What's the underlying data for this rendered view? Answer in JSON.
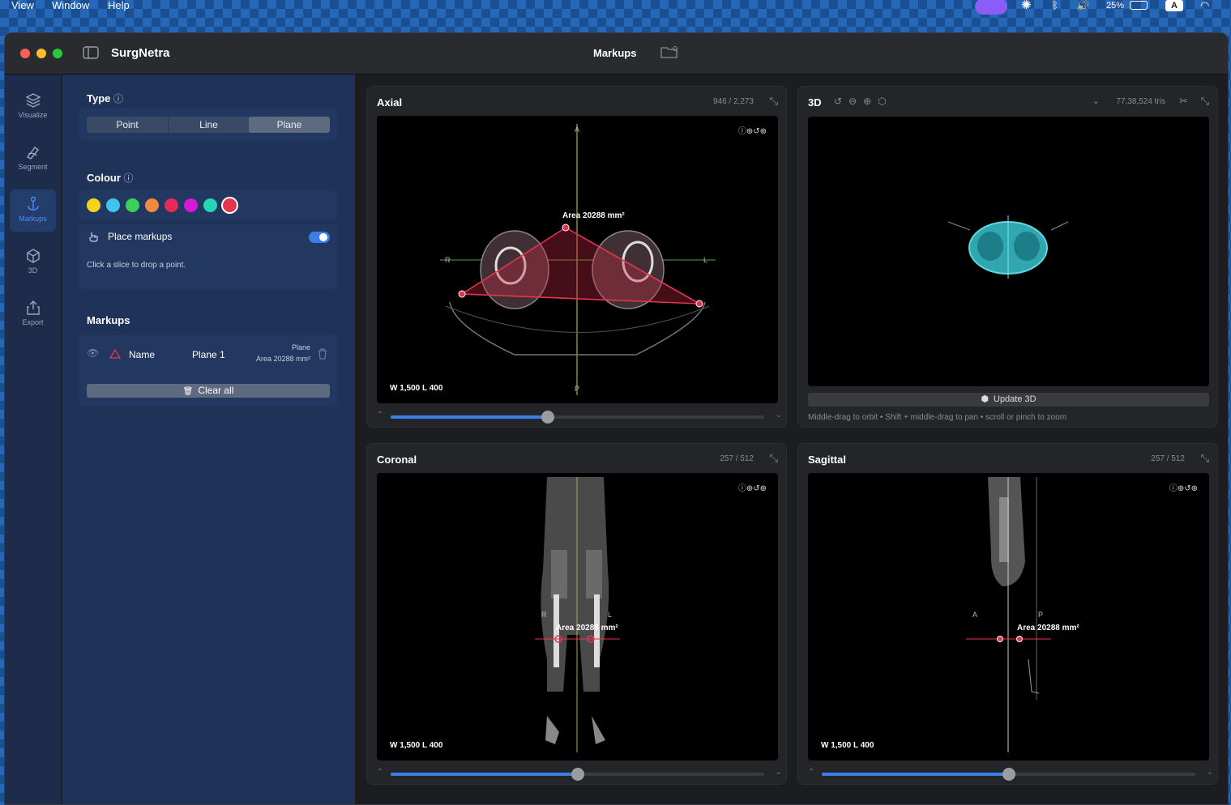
{
  "menubar": {
    "view": "View",
    "window": "Window",
    "help": "Help",
    "battery": "25%"
  },
  "app": {
    "title": "SurgNetra",
    "center_title": "Markups"
  },
  "rail": [
    {
      "label": "Visualize",
      "icon": "layers-icon"
    },
    {
      "label": "Segment",
      "icon": "brush-icon"
    },
    {
      "label": "Markups",
      "icon": "pin-icon",
      "active": true
    },
    {
      "label": "3D",
      "icon": "cube-icon"
    },
    {
      "label": "Export",
      "icon": "share-icon"
    }
  ],
  "panel": {
    "type_title": "Type",
    "types": [
      "Point",
      "Line",
      "Plane"
    ],
    "selected_type": "Plane",
    "colour_title": "Colour",
    "colours": [
      "#f4d41a",
      "#3fc4f0",
      "#3bd05a",
      "#f08a3c",
      "#e52a5a",
      "#d21ad8",
      "#27d4b4",
      "#e5354d"
    ],
    "selected_colour": "#e5354d",
    "place_label": "Place markups",
    "place_enabled": true,
    "hint": "Click a slice to drop a point.",
    "markups_title": "Markups",
    "markup": {
      "header": "Name",
      "name": "Plane 1",
      "kind": "Plane",
      "detail": "Area 20288 mm²"
    },
    "clear_label": "Clear all"
  },
  "views": {
    "axial": {
      "title": "Axial",
      "count": "946 / 2,273",
      "wl": "W 1,500  L 400",
      "slider": 0.42,
      "labels": {
        "a": "A",
        "p": "P",
        "r": "R",
        "l": "L"
      }
    },
    "three_d": {
      "title": "3D",
      "tris": "77,38,524 tris",
      "update_label": "Update 3D",
      "hint": "Middle-drag to orbit • Shift + middle-drag to pan • scroll or pinch to zoom"
    },
    "coronal": {
      "title": "Coronal",
      "count": "257 / 512",
      "wl": "W 1,500  L 400",
      "slider": 0.5,
      "labels": {
        "r": "R",
        "l": "L"
      }
    },
    "sagittal": {
      "title": "Sagittal",
      "count": "257 / 512",
      "wl": "W 1,500  L 400",
      "slider": 0.5,
      "labels": {
        "a": "A",
        "p": "P"
      }
    }
  },
  "annotation": "Area 20288 mm²",
  "accent": "#3b7ee6",
  "markup_color": "#e5354d"
}
